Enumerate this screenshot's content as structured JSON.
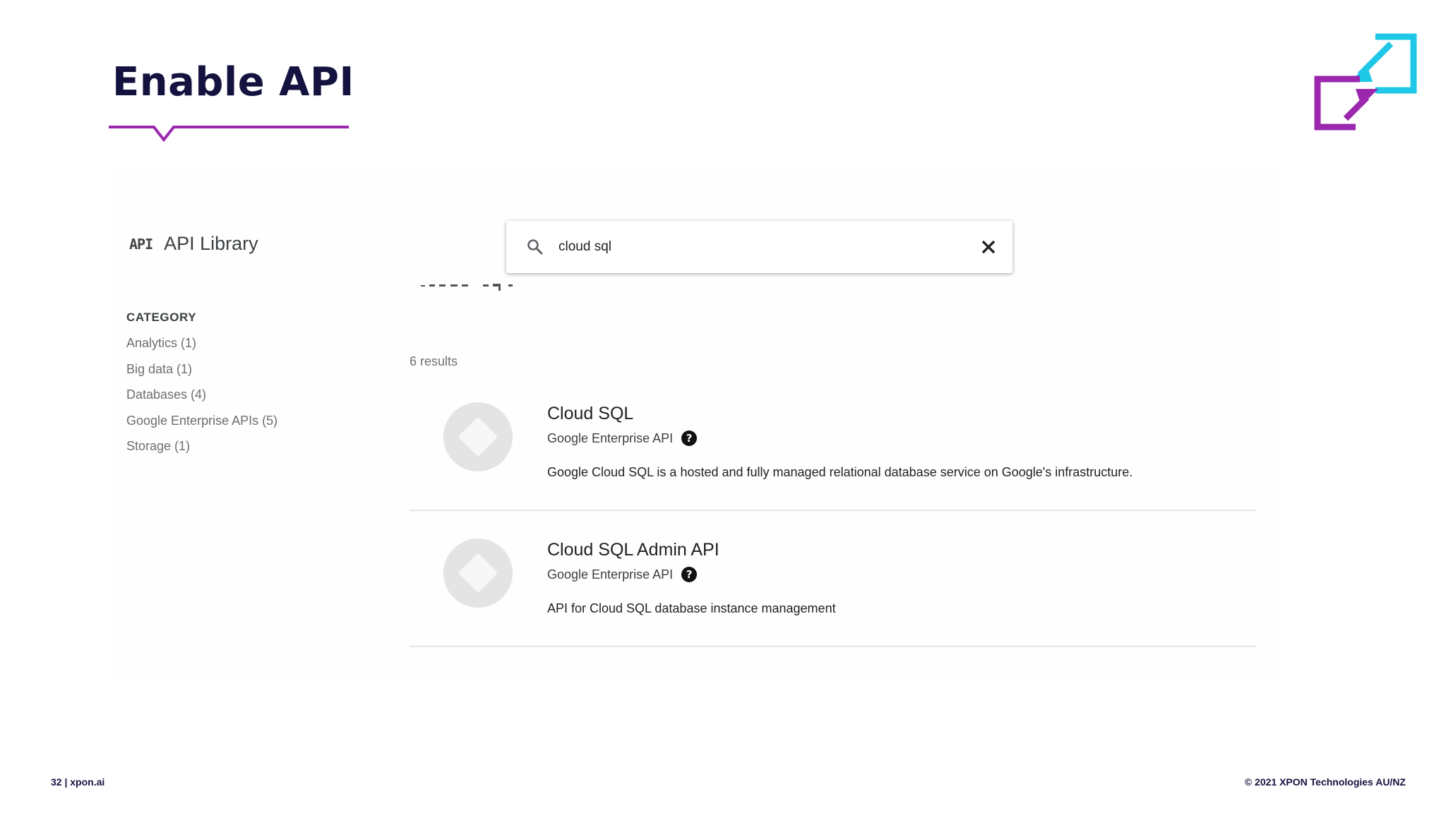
{
  "slide": {
    "title": "Enable API",
    "footer_left": "32 | xpon.ai",
    "footer_right": "© 2021 XPON Technologies AU/NZ",
    "accent_color": "#9b27af",
    "logo_colors": [
      "#9b27af",
      "#1ec8e6"
    ]
  },
  "sidebar": {
    "api_glyph": "API",
    "title": "API Library",
    "category_heading": "CATEGORY",
    "categories": [
      {
        "label": "Analytics (1)"
      },
      {
        "label": "Big data (1)"
      },
      {
        "label": "Databases (4)"
      },
      {
        "label": "Google Enterprise APIs (5)"
      },
      {
        "label": "Storage (1)"
      }
    ]
  },
  "search": {
    "value": "cloud sql",
    "icon": "search-icon",
    "clear_icon": "close-icon"
  },
  "results": {
    "count_label": "6 results",
    "items": [
      {
        "name": "Cloud SQL",
        "provider": "Google Enterprise API",
        "help_glyph": "?",
        "description": "Google Cloud SQL is a hosted and fully managed relational database service on Google's infrastructure."
      },
      {
        "name": "Cloud SQL Admin API",
        "provider": "Google Enterprise API",
        "help_glyph": "?",
        "description": "API for Cloud SQL database instance management"
      }
    ]
  }
}
